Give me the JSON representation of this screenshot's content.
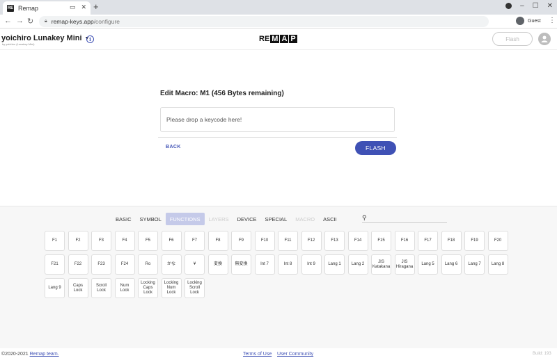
{
  "browser": {
    "tab_title": "Remap",
    "favicon": "RE",
    "url_host": "remap-keys.app",
    "url_path": "/configure",
    "profile_label": "Guest"
  },
  "app": {
    "keyboard_name": "yoichiro Lunakey Mini",
    "keyboard_sub": "by yoichiro (Lunakey Mini)",
    "logo_plain": "RE",
    "logo_boxes": [
      "M",
      "A",
      "P"
    ],
    "flash_top_label": "Flash"
  },
  "macro": {
    "title": "Edit Macro: M1 (456 Bytes remaining)",
    "drop_placeholder": "Please drop a keycode here!",
    "back_label": "BACK",
    "flash_label": "FLASH"
  },
  "categories": [
    {
      "label": "BASIC",
      "state": "normal"
    },
    {
      "label": "SYMBOL",
      "state": "normal"
    },
    {
      "label": "FUNCTIONS",
      "state": "active"
    },
    {
      "label": "LAYERS",
      "state": "disabled"
    },
    {
      "label": "DEVICE",
      "state": "normal"
    },
    {
      "label": "SPECIAL",
      "state": "normal"
    },
    {
      "label": "MACRO",
      "state": "disabled"
    },
    {
      "label": "ASCII",
      "state": "normal"
    }
  ],
  "keys": [
    [
      "F1",
      "F2",
      "F3",
      "F4",
      "F5",
      "F6",
      "F7",
      "F8",
      "F9",
      "F10",
      "F11",
      "F12",
      "F13",
      "F14",
      "F15",
      "F16",
      "F17",
      "F18",
      "F19",
      "F20"
    ],
    [
      "F21",
      "F22",
      "F23",
      "F24",
      "Ro",
      "かな",
      "¥",
      "変換",
      "無変換",
      "Int 7",
      "Int 8",
      "Int 9",
      "Lang 1",
      "Lang 2",
      "JIS Katakana",
      "JIS Hiragana",
      "Lang 5",
      "Lang 6",
      "Lang 7",
      "Lang 8"
    ],
    [
      "Lang 9",
      "Caps Lock",
      "Scroll Lock",
      "Num Lock",
      "Locking Caps Lock",
      "Locking Num Lock",
      "Locking Scroll Lock"
    ]
  ],
  "footer": {
    "copyright": "©2020-2021 ",
    "team_link": "Remap team.",
    "terms": "Terms of Use",
    "community": "User Community",
    "build": "Build: 193"
  }
}
